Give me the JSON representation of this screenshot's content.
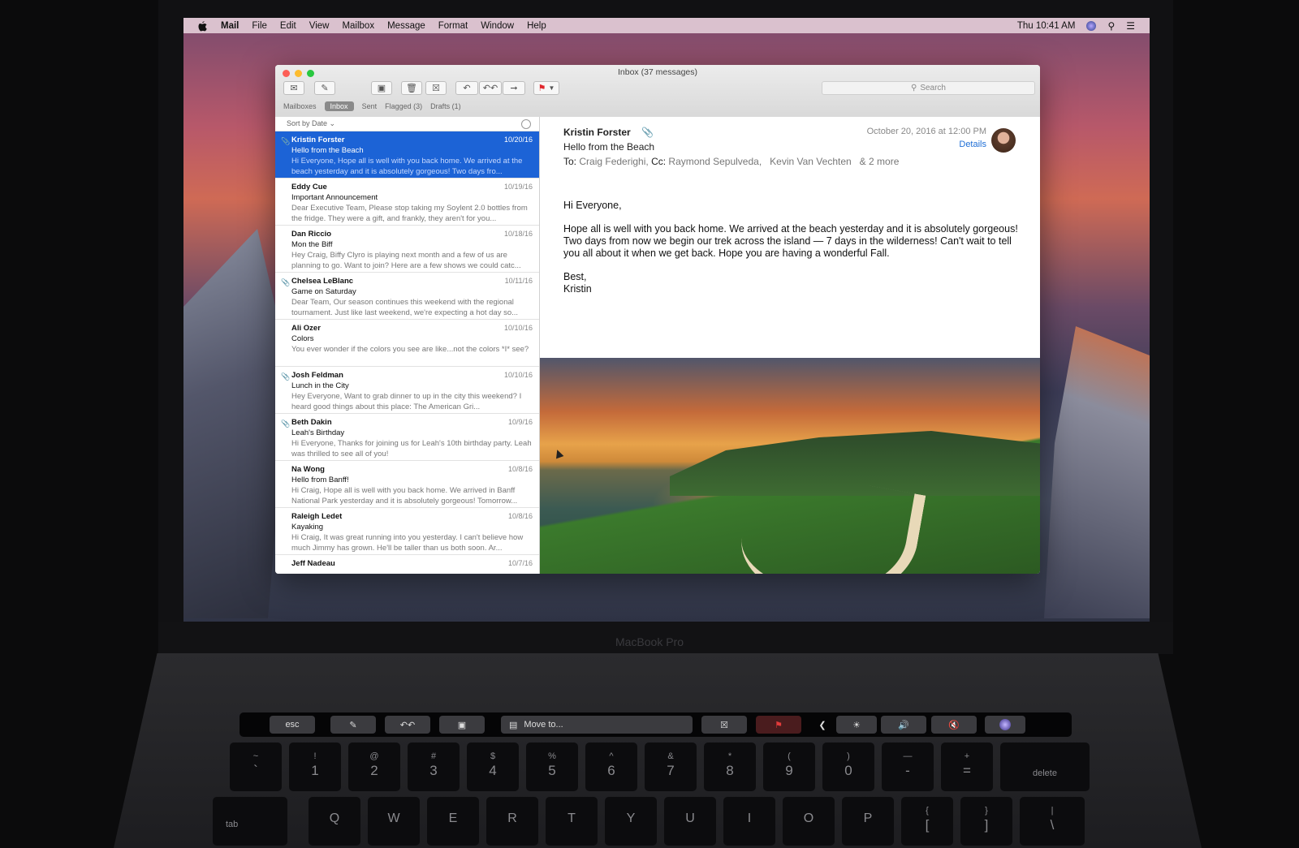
{
  "menubar": {
    "app": "Mail",
    "items": [
      "File",
      "Edit",
      "View",
      "Mailbox",
      "Message",
      "Format",
      "Window",
      "Help"
    ],
    "clock": "Thu 10:41 AM"
  },
  "window": {
    "title": "Inbox (37 messages)",
    "search_placeholder": "Search",
    "favorites": {
      "mailboxes": "Mailboxes",
      "inbox": "Inbox",
      "sent": "Sent",
      "flagged": "Flagged (3)",
      "drafts": "Drafts (1)"
    },
    "sort_label": "Sort by Date ⌄"
  },
  "messages": [
    {
      "from": "Kristin Forster",
      "subject": "Hello from the Beach",
      "preview": "Hi Everyone, Hope all is well with you back home. We arrived at the beach yesterday and it is absolutely gorgeous! Two days fro...",
      "date": "10/20/16"
    },
    {
      "from": "Eddy Cue",
      "subject": "Important Announcement",
      "preview": "Dear Executive Team, Please stop taking my Soylent 2.0 bottles from the fridge. They were a gift, and frankly, they aren't for you...",
      "date": "10/19/16"
    },
    {
      "from": "Dan Riccio",
      "subject": "Mon the Biff",
      "preview": "Hey Craig, Biffy Clyro is playing next month and a few of us are planning to go. Want to join? Here are a few shows we could catc...",
      "date": "10/18/16"
    },
    {
      "from": "Chelsea LeBlanc",
      "subject": "Game on Saturday",
      "preview": "Dear Team, Our season continues this weekend with the regional tournament. Just like last weekend, we're expecting a hot day so...",
      "date": "10/11/16"
    },
    {
      "from": "Ali Ozer",
      "subject": "Colors",
      "preview": "You ever wonder if the colors you see are like...not the colors *I* see?",
      "date": "10/10/16"
    },
    {
      "from": "Josh Feldman",
      "subject": "Lunch in the City",
      "preview": "Hey Everyone, Want to grab dinner to up in the city this weekend? I heard good things about this place: The American Gri...",
      "date": "10/10/16"
    },
    {
      "from": "Beth Dakin",
      "subject": "Leah's Birthday",
      "preview": "Hi Everyone, Thanks for joining us for Leah's 10th birthday party. Leah was thrilled to see all of you!",
      "date": "10/9/16"
    },
    {
      "from": "Na Wong",
      "subject": "Hello from Banff!",
      "preview": "Hi Craig, Hope all is well with you back home. We arrived in Banff National Park yesterday and it is absolutely gorgeous! Tomorrow...",
      "date": "10/8/16"
    },
    {
      "from": "Raleigh Ledet",
      "subject": "Kayaking",
      "preview": "Hi Craig, It was great running into you yesterday. I can't believe how much Jimmy has grown. He'll be taller than us both soon. Ar...",
      "date": "10/8/16"
    },
    {
      "from": "Jeff Nadeau",
      "subject": "",
      "preview": "",
      "date": "10/7/16"
    }
  ],
  "reading": {
    "from": "Kristin Forster",
    "date": "October 20, 2016 at 12:00 PM",
    "details": "Details",
    "subject": "Hello from the Beach",
    "to_label": "To:",
    "to": "Craig Federighi,",
    "cc_label": "Cc:",
    "cc": "Raymond Sepulveda,   Kevin Van Vechten   & 2 more",
    "greeting": "Hi Everyone,",
    "paragraph": "Hope all is well with you back home. We arrived at the beach yesterday and it is absolutely gorgeous! Two days from now we begin our trek across the island — 7 days in the wilderness! Can't wait to tell you all about it when we get back. Hope you are having a wonderful Fall.",
    "signoff": "Best,",
    "signature": "Kristin"
  },
  "laptop": {
    "brand": "MacBook Pro"
  },
  "touchbar": {
    "esc": "esc",
    "move_to": "Move to..."
  },
  "keys": [
    {
      "top": "~",
      "main": "`"
    },
    {
      "top": "!",
      "main": "1"
    },
    {
      "top": "@",
      "main": "2"
    },
    {
      "top": "#",
      "main": "3"
    },
    {
      "top": "$",
      "main": "4"
    },
    {
      "top": "%",
      "main": "5"
    },
    {
      "top": "^",
      "main": "6"
    },
    {
      "top": "&",
      "main": "7"
    },
    {
      "top": "*",
      "main": "8"
    },
    {
      "top": "(",
      "main": "9"
    },
    {
      "top": ")",
      "main": "0"
    },
    {
      "top": "—",
      "main": "-"
    },
    {
      "top": "+",
      "main": "="
    }
  ],
  "delete_key": "delete",
  "tab_key": "tab",
  "letters": [
    "Q",
    "W",
    "E",
    "R",
    "T",
    "Y",
    "U",
    "I",
    "O",
    "P"
  ],
  "brackets": [
    {
      "top": "{",
      "main": "["
    },
    {
      "top": "}",
      "main": "]"
    },
    {
      "top": "|",
      "main": "\\"
    }
  ]
}
